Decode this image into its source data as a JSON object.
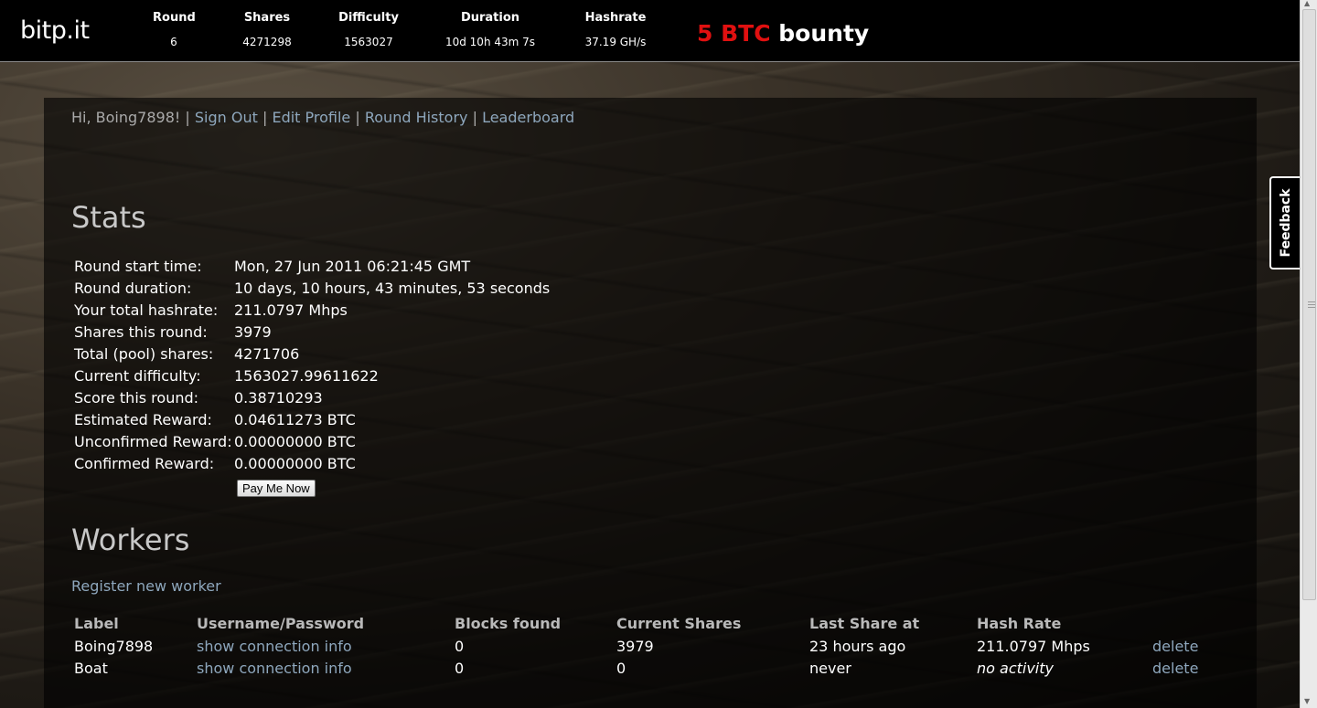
{
  "header": {
    "logo": "bitp.it",
    "stats": [
      {
        "label": "Round",
        "value": "6"
      },
      {
        "label": "Shares",
        "value": "4271298"
      },
      {
        "label": "Difficulty",
        "value": "1563027"
      },
      {
        "label": "Duration",
        "value": "10d 10h 43m 7s"
      },
      {
        "label": "Hashrate",
        "value": "37.19 GH/s"
      }
    ],
    "bounty_amount": "5 BTC",
    "bounty_word": "bounty"
  },
  "feedback_tab": "Feedback",
  "nav": {
    "greeting": "Hi, Boing7898!",
    "links": [
      "Sign Out",
      "Edit Profile",
      "Round History",
      "Leaderboard"
    ],
    "separator": "|"
  },
  "stats": {
    "heading": "Stats",
    "rows": [
      {
        "label": "Round start time:",
        "value": "Mon, 27 Jun 2011 06:21:45 GMT"
      },
      {
        "label": "Round duration:",
        "value": "10 days, 10 hours, 43 minutes, 53 seconds"
      },
      {
        "label": "Your total hashrate:",
        "value": "211.0797 Mhps"
      },
      {
        "label": "Shares this round:",
        "value": "3979"
      },
      {
        "label": "Total (pool) shares:",
        "value": "4271706"
      },
      {
        "label": "Current difficulty:",
        "value": "1563027.99611622"
      },
      {
        "label": "Score this round:",
        "value": "0.38710293"
      },
      {
        "label": "Estimated Reward:",
        "value": "0.04611273 BTC"
      },
      {
        "label": "Unconfirmed Reward:",
        "value": "0.00000000 BTC"
      },
      {
        "label": "Confirmed Reward:",
        "value": "0.00000000 BTC"
      }
    ],
    "pay_button": "Pay Me Now"
  },
  "workers": {
    "heading": "Workers",
    "register_link": "Register new worker",
    "columns": [
      "Label",
      "Username/Password",
      "Blocks found",
      "Current Shares",
      "Last Share at",
      "Hash Rate"
    ],
    "rows": [
      {
        "label": "Boing7898",
        "connection": "show connection info",
        "blocks": "0",
        "shares": "3979",
        "last_share": "23 hours ago",
        "hash_rate": "211.0797 Mhps",
        "delete": "delete"
      },
      {
        "label": "Boat",
        "connection": "show connection info",
        "blocks": "0",
        "shares": "0",
        "last_share": "never",
        "hash_rate": "no activity",
        "delete": "delete"
      }
    ]
  }
}
